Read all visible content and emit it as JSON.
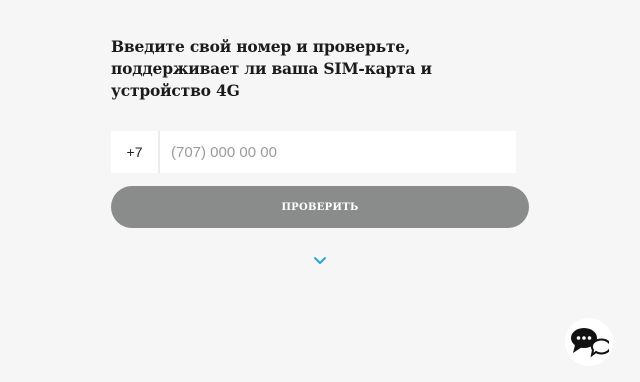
{
  "heading": "Введите свой номер и проверьте, поддерживает ли ваша SIM-карта и устройство 4G",
  "phone": {
    "country_code": "+7",
    "value": "",
    "placeholder": "(707) 000 00 00"
  },
  "check_button_label": "ПРОВЕРИТЬ",
  "icons": {
    "expand": "chevron-down-icon",
    "chat": "chat-bubbles-icon"
  },
  "colors": {
    "background": "#f6f6f6",
    "button": "#8a8b8b",
    "accent": "#2aa3d8",
    "chat_icon": "#111111"
  }
}
